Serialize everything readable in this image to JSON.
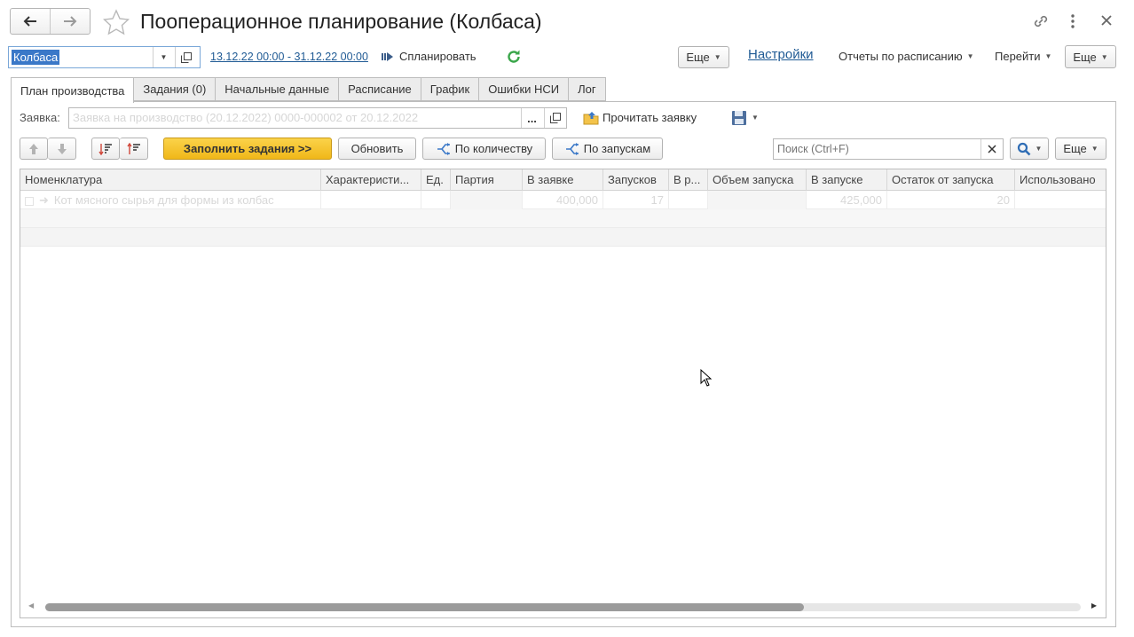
{
  "window": {
    "title": "Пооперационное планирование (Колбаса)"
  },
  "toolbar": {
    "product_value": "Колбаса",
    "period_link": "13.12.22 00:00 - 31.12.22 00:00",
    "plan_label": "Спланировать",
    "more_label": "Еще",
    "settings_link": "Настройки",
    "reports_label": "Отчеты по расписанию",
    "goto_label": "Перейти",
    "more2_label": "Еще"
  },
  "tabs": [
    {
      "label": "План производства",
      "active": true
    },
    {
      "label": "Задания (0)"
    },
    {
      "label": "Начальные данные"
    },
    {
      "label": "Расписание"
    },
    {
      "label": "График"
    },
    {
      "label": "Ошибки НСИ"
    },
    {
      "label": "Лог"
    }
  ],
  "request": {
    "label": "Заявка:",
    "value": "Заявка на производство (20.12.2022) 0000-000002 от 20.12.2022",
    "select_label": "...",
    "read_label": "Прочитать заявку"
  },
  "grid_toolbar": {
    "fill_label": "Заполнить задания >>",
    "refresh_label": "Обновить",
    "by_qty_label": "По количеству",
    "by_runs_label": "По запускам",
    "search_placeholder": "Поиск (Ctrl+F)",
    "more_label": "Еще"
  },
  "grid": {
    "columns": [
      "Номенклатура",
      "Характеристи...",
      "Ед.",
      "Партия",
      "В заявке",
      "Запусков",
      "В р...",
      "Объем запуска",
      "В запуске",
      "Остаток от запуска",
      "Использовано"
    ],
    "rows": [
      {
        "name": "Кот мясного сырья для формы из колбас",
        "char": "",
        "unit": "",
        "batch": "",
        "in_request": "400,000",
        "runs": "17",
        "in_work": "",
        "run_volume": "",
        "in_run": "425,000",
        "remainder": "20",
        "used": ""
      }
    ]
  },
  "colors": {
    "accent_yellow": "#f7c726",
    "link_blue": "#1f5a94",
    "refresh_green": "#3aa64a"
  }
}
